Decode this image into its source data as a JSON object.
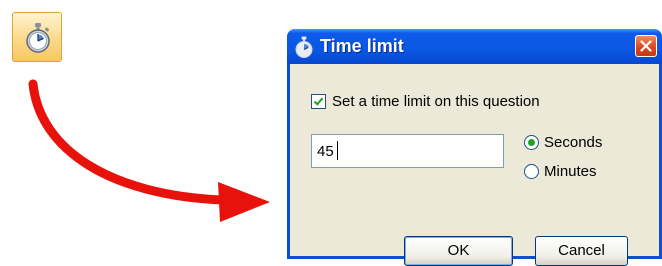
{
  "toolbar": {
    "timer_icon": "stopwatch-icon"
  },
  "dialog": {
    "title": "Time limit",
    "title_icon": "stopwatch-icon",
    "close_icon": "close-icon",
    "checkbox": {
      "label": "Set a time limit on this question",
      "checked": true
    },
    "time_input": {
      "value": "45"
    },
    "units": {
      "options": [
        "Seconds",
        "Minutes"
      ],
      "selected": "Seconds"
    },
    "buttons": {
      "ok_label": "OK",
      "cancel_label": "Cancel"
    }
  },
  "colors": {
    "arrow": "#e8120c",
    "title_bar": "#0a58e4",
    "dialog_bg": "#ece9d8",
    "close_button": "#d9441c"
  }
}
